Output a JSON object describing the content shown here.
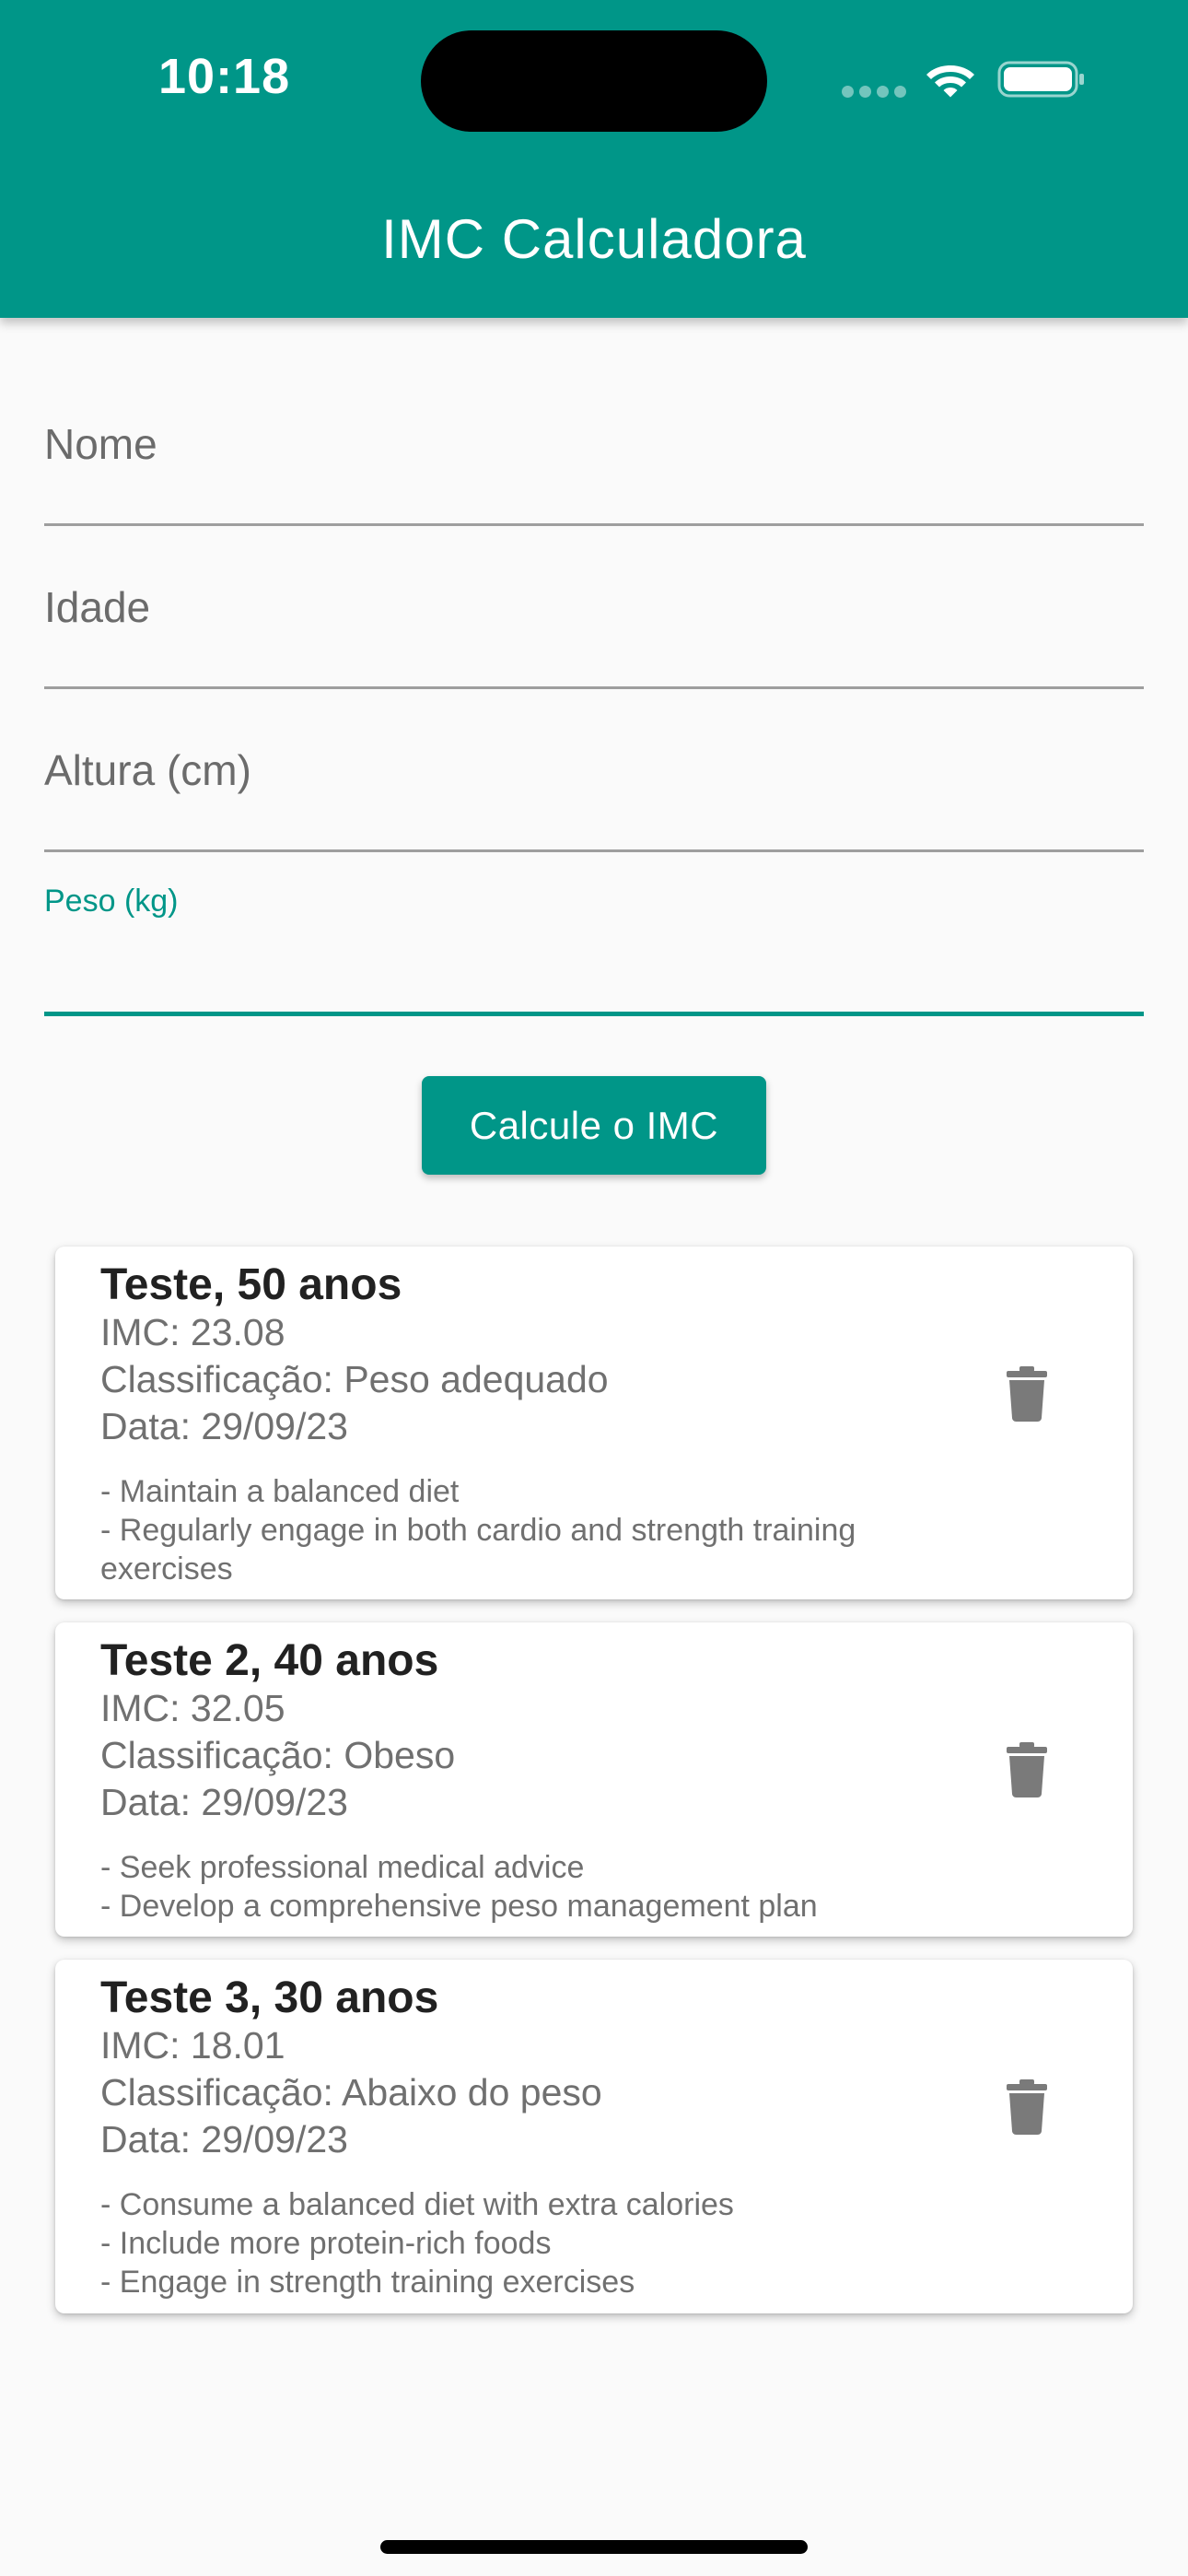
{
  "status_bar": {
    "time": "10:18"
  },
  "app_bar": {
    "title": "IMC Calculadora"
  },
  "form": {
    "nome_label": "Nome",
    "idade_label": "Idade",
    "altura_label": "Altura (cm)",
    "peso_label": "Peso (kg)",
    "nome_value": "",
    "idade_value": "",
    "altura_value": "",
    "peso_value": "",
    "button_label": "Calcule o IMC"
  },
  "results": [
    {
      "title": "Teste, 50 anos",
      "imc": "IMC: 23.08",
      "classificacao": "Classificação: Peso adequado",
      "data": "Data: 29/09/23",
      "tips": [
        "- Maintain a balanced diet",
        "- Regularly engage in both cardio and strength training exercises"
      ]
    },
    {
      "title": "Teste 2, 40 anos",
      "imc": "IMC: 32.05",
      "classificacao": "Classificação: Obeso",
      "data": "Data: 29/09/23",
      "tips": [
        "- Seek professional medical advice",
        "- Develop a comprehensive peso management plan"
      ]
    },
    {
      "title": "Teste 3, 30 anos",
      "imc": "IMC: 18.01",
      "classificacao": "Classificação: Abaixo do peso",
      "data": "Data: 29/09/23",
      "tips": [
        "- Consume a balanced diet with extra calories",
        "- Include more protein-rich foods",
        "- Engage in strength training exercises"
      ]
    }
  ],
  "icons": {
    "delete": "trash-icon",
    "wifi": "wifi-icon",
    "battery": "battery-icon",
    "signal": "cellular-signal-icon"
  },
  "colors": {
    "primary": "#009688",
    "background": "#fafafa",
    "card": "#ffffff",
    "secondary_text": "#707070",
    "icon_grey": "#7a7a7a"
  }
}
